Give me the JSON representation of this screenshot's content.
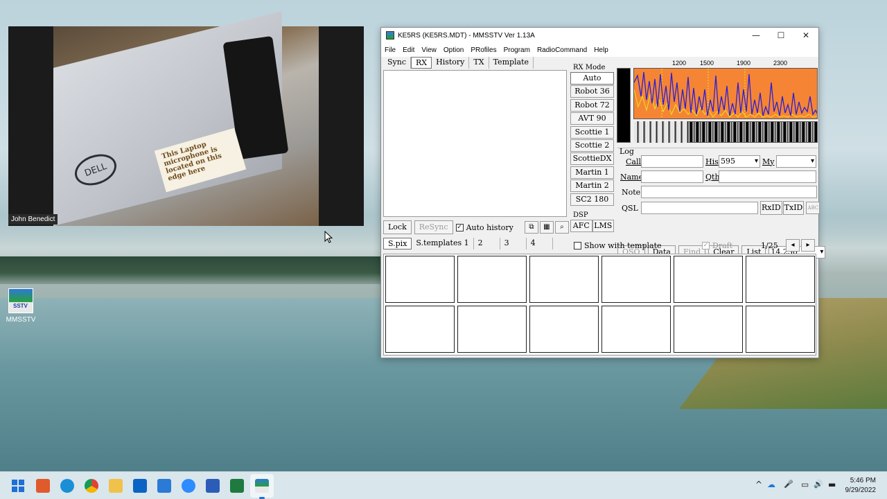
{
  "video": {
    "participant_name": "John Benedict",
    "sticker_text": "This Laptop microphone is located on this edge here",
    "logo_text": "DELL"
  },
  "desktop_icon": {
    "label": "MMSSTV",
    "icon_text": "SSTV"
  },
  "window": {
    "title": "KE5RS (KE5RS.MDT) - MMSSTV Ver 1.13A",
    "controls": {
      "minimize": "—",
      "maximize": "☐",
      "close": "✕"
    },
    "menu": [
      "File",
      "Edit",
      "View",
      "Option",
      "PRofiles",
      "Program",
      "RadioCommand",
      "Help"
    ],
    "tabs": [
      "Sync",
      "RX",
      "History",
      "TX",
      "Template"
    ],
    "active_tab": "RX",
    "rx_buttons": {
      "lock": "Lock",
      "resync": "ReSync",
      "auto_history": "Auto history",
      "auto_history_checked": true,
      "check_mark": "✓"
    },
    "rx_mode": {
      "label": "RX Mode",
      "modes": [
        "Auto",
        "Robot 36",
        "Robot 72",
        "AVT 90",
        "Scottie 1",
        "Scottie 2",
        "ScottieDX",
        "Martin 1",
        "Martin 2",
        "SC2 180"
      ],
      "selected": "Auto"
    },
    "dsp": {
      "label": "DSP",
      "afc": "AFC",
      "lms": "LMS"
    },
    "spectrum": {
      "scale": [
        "1200",
        "1500",
        "1900",
        "2300"
      ],
      "bg_color": "#f58534",
      "trace_color": "#2b1ed6",
      "peak_color": "#e8e61e"
    },
    "log": {
      "label": "Log",
      "call_label": "Call",
      "call_value": "",
      "his_label": "His",
      "his_value": "595",
      "my_label": "My",
      "my_value": "",
      "name_label": "Name",
      "qth_label": "Qth",
      "note_label": "Note",
      "qsl_label": "QSL",
      "rxid": "RxID",
      "txid": "TxID",
      "buttons": {
        "qso": "QSO",
        "data": "Data",
        "find": "Find",
        "clear": "Clear",
        "list": "List"
      },
      "frequency": "14.230"
    },
    "pix_tabs": [
      "S.pix",
      "S.templates 1",
      "2",
      "3",
      "4"
    ],
    "show_with_template": "Show with template",
    "draft": "Draft",
    "draft_check_mark": "✓",
    "page_indicator": "1/25",
    "prev_icon": "◂",
    "next_icon": "▸"
  },
  "taskbar": {
    "clock_time": "5:46 PM",
    "clock_date": "9/29/2022",
    "tray": {
      "chevron": "^",
      "cloud": "☁",
      "mic": "🎤",
      "network": "▭",
      "volume": "🔊",
      "battery": "▬"
    },
    "apps": [
      "start",
      "snipping-tool",
      "edge",
      "chrome",
      "file-explorer",
      "outlook",
      "mail",
      "zoom",
      "word",
      "excel",
      "mmsstv"
    ],
    "app_colors": [
      "#1f6fd6",
      "#e05a2b",
      "#1b8fd6",
      "#e0b21b",
      "#f0c24c",
      "#0b63c4",
      "#2a7ad6",
      "#2d8cff",
      "#2b5db8",
      "#1e7a3e",
      "#4a6c9a"
    ]
  }
}
